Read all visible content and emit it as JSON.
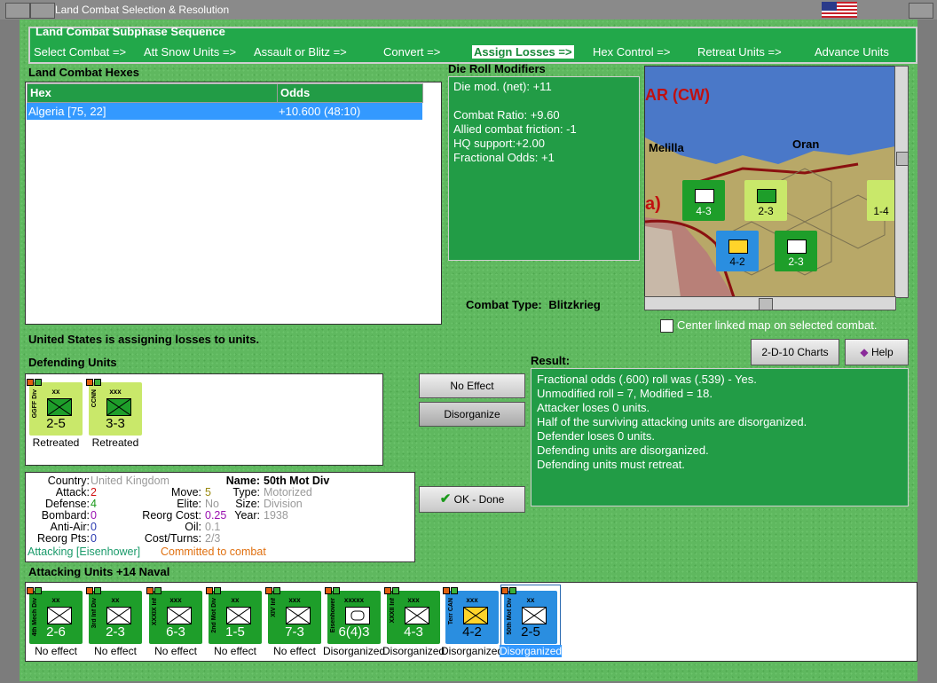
{
  "window": {
    "title": "Land Combat Selection & Resolution"
  },
  "subphase": {
    "title": "Land Combat Subphase Sequence",
    "steps": [
      "Select Combat =>",
      "Att Snow Units =>",
      "Assault or Blitz =>",
      "Convert =>",
      "Assign Losses =>",
      "Hex Control =>",
      "Retreat Units =>",
      "Advance Units"
    ],
    "active_index": 4
  },
  "hexes": {
    "title": "Land Combat Hexes",
    "columns": [
      "Hex",
      "Odds"
    ],
    "rows": [
      {
        "hex": "Algeria [75, 22]",
        "odds": "+10.600 (48:10)"
      }
    ]
  },
  "die_roll": {
    "title": "Die Roll Modifiers",
    "lines": [
      "Die mod. (net): +11",
      "",
      "Combat Ratio: +9.60",
      "Allied combat friction: -1",
      "HQ support:+2.00",
      "Fractional Odds: +1"
    ]
  },
  "map": {
    "region_label": "AR (CW)",
    "region_label2": "a)",
    "city1": "Melilla",
    "city2": "Oran",
    "units": [
      {
        "str": "4-3",
        "num": "3"
      },
      {
        "str": "2-3",
        "num": "2"
      },
      {
        "str": "4-2",
        "num": "3"
      },
      {
        "str": "2-3",
        "num": "3"
      },
      {
        "str": "1-4",
        "num": "3"
      }
    ]
  },
  "combat_type": {
    "label": "Combat Type:",
    "value": "Blitzkrieg"
  },
  "center_map": {
    "label": "Center linked map on selected combat.",
    "checked": false
  },
  "status_line": "United States is assigning losses to units.",
  "defending": {
    "title": "Defending Units",
    "units": [
      {
        "name": "GGFF Div",
        "size": "xx",
        "str": "2-5",
        "caption": "Retreated",
        "color": "lime"
      },
      {
        "name": "CCNN",
        "size": "xxx",
        "str": "3-3",
        "caption": "Retreated",
        "color": "lime"
      }
    ]
  },
  "buttons": {
    "no_effect": "No Effect",
    "disorganize": "Disorganize",
    "ok_done": "OK - Done",
    "charts": "2-D-10 Charts",
    "help": "Help"
  },
  "result": {
    "title": "Result:",
    "lines": [
      "Fractional odds (.600) roll was (.539)  - Yes.",
      "Unmodified roll = 7, Modified = 18.",
      "Attacker loses 0 units.",
      "Half of the surviving attacking units are disorganized.",
      "Defender loses 0 units.",
      "Defending units are disorganized.",
      "Defending units must retreat."
    ]
  },
  "unit_detail": {
    "country_label": "Country:",
    "country": "United Kingdom",
    "attack_label": "Attack:",
    "attack": "2",
    "defense_label": "Defense:",
    "defense": "4",
    "bombard_label": "Bombard:",
    "bombard": "0",
    "antiair_label": "Anti-Air:",
    "antiair": "0",
    "reorgpts_label": "Reorg Pts:",
    "reorgpts": "0",
    "move_label": "Move:",
    "move": "5",
    "elite_label": "Elite:",
    "elite": "No",
    "reorgcost_label": "Reorg Cost:",
    "reorgcost": "0.25",
    "oil_label": "Oil:",
    "oil": "0.1",
    "costturns_label": "Cost/Turns:",
    "costturns": "2/3",
    "name_label": "Name:",
    "name": "50th Mot Div",
    "type_label": "Type:",
    "type": "Motorized",
    "size_label": "Size:",
    "size": "Division",
    "year_label": "Year:",
    "year": "1938",
    "attacking": "Attacking [Eisenhower]",
    "committed": "Committed to combat"
  },
  "attacking": {
    "title": "Attacking Units +14 Naval",
    "units": [
      {
        "name": "4th Mech Div",
        "size": "xx",
        "str": "2-6",
        "caption": "No effect",
        "color": "green"
      },
      {
        "name": "3rd Inf Div",
        "size": "xx",
        "str": "2-3",
        "caption": "No effect",
        "color": "green"
      },
      {
        "name": "XXXIX Inf",
        "size": "xxx",
        "str": "6-3",
        "caption": "No effect",
        "color": "green"
      },
      {
        "name": "2nd Mot Div",
        "size": "xx",
        "str": "1-5",
        "caption": "No effect",
        "color": "green"
      },
      {
        "name": "XIV Inf",
        "size": "xxx",
        "str": "7-3",
        "caption": "No effect",
        "color": "green"
      },
      {
        "name": "Eisenhower",
        "size": "xxxxx",
        "str": "6(4)3",
        "caption": "Disorganized",
        "color": "green"
      },
      {
        "name": "XXXII Inf",
        "size": "xxx",
        "str": "4-3",
        "caption": "Disorganized",
        "color": "green"
      },
      {
        "name": "Terr CAN",
        "size": "xxx",
        "str": "4-2",
        "caption": "Disorganized",
        "color": "blue"
      },
      {
        "name": "50th Mot Div",
        "size": "xx",
        "str": "2-5",
        "caption": "Disorganized",
        "color": "blue"
      }
    ]
  },
  "colors": {
    "accent": "#22a84a",
    "selected": "#3399ff",
    "attack_red": "#d01010",
    "defense_green": "#1a9a1a",
    "bombard_purple": "#9a10b0",
    "committed_orange": "#e07010"
  }
}
